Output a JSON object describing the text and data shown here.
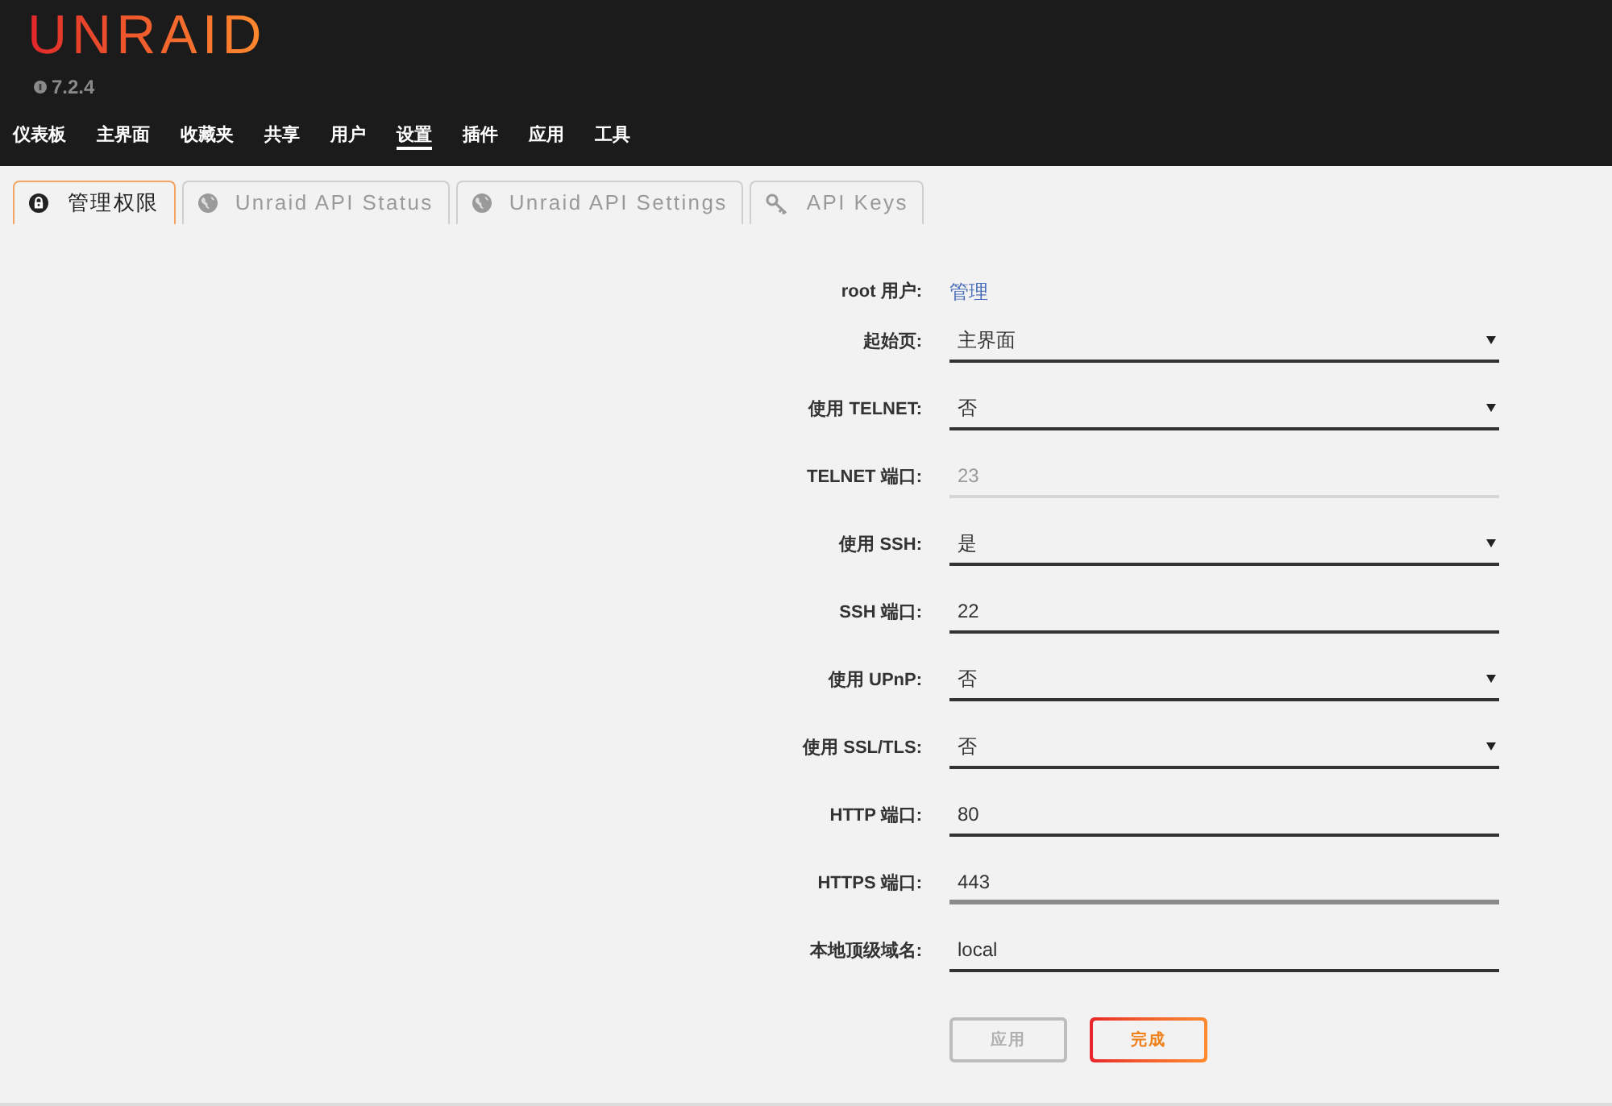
{
  "header": {
    "logo": "UNRAID",
    "version": "7.2.4"
  },
  "nav": [
    {
      "label": "仪表板",
      "selected": false
    },
    {
      "label": "主界面",
      "selected": false
    },
    {
      "label": "收藏夹",
      "selected": false
    },
    {
      "label": "共享",
      "selected": false
    },
    {
      "label": "用户",
      "selected": false
    },
    {
      "label": "设置",
      "selected": true
    },
    {
      "label": "插件",
      "selected": false
    },
    {
      "label": "应用",
      "selected": false
    },
    {
      "label": "工具",
      "selected": false
    }
  ],
  "tabs": [
    {
      "label": "管理权限",
      "selected": true
    },
    {
      "label": "Unraid API Status",
      "selected": false
    },
    {
      "label": "Unraid API Settings",
      "selected": false
    },
    {
      "label": "API Keys",
      "selected": false
    }
  ],
  "form": {
    "rows": [
      {
        "kind": "link",
        "label": "root 用户:",
        "value": "管理",
        "disabled": false,
        "focused": false
      },
      {
        "kind": "select",
        "label": "起始页:",
        "value": "主界面",
        "disabled": false,
        "focused": false
      },
      {
        "kind": "select",
        "label": "使用 TELNET:",
        "value": "否",
        "disabled": false,
        "focused": false
      },
      {
        "kind": "text",
        "label": "TELNET 端口:",
        "value": "23",
        "disabled": true,
        "focused": false
      },
      {
        "kind": "select",
        "label": "使用 SSH:",
        "value": "是",
        "disabled": false,
        "focused": false
      },
      {
        "kind": "text",
        "label": "SSH 端口:",
        "value": "22",
        "disabled": false,
        "focused": false
      },
      {
        "kind": "select",
        "label": "使用 UPnP:",
        "value": "否",
        "disabled": false,
        "focused": false
      },
      {
        "kind": "select",
        "label": "使用 SSL/TLS:",
        "value": "否",
        "disabled": false,
        "focused": false
      },
      {
        "kind": "text",
        "label": "HTTP 端口:",
        "value": "80",
        "disabled": false,
        "focused": false
      },
      {
        "kind": "text",
        "label": "HTTPS 端口:",
        "value": "443",
        "disabled": false,
        "focused": true
      },
      {
        "kind": "text",
        "label": "本地顶级域名:",
        "value": "local",
        "disabled": false,
        "focused": false
      }
    ],
    "buttons": [
      {
        "label": "应用",
        "disabled": true
      },
      {
        "label": "完成",
        "disabled": false
      }
    ]
  }
}
